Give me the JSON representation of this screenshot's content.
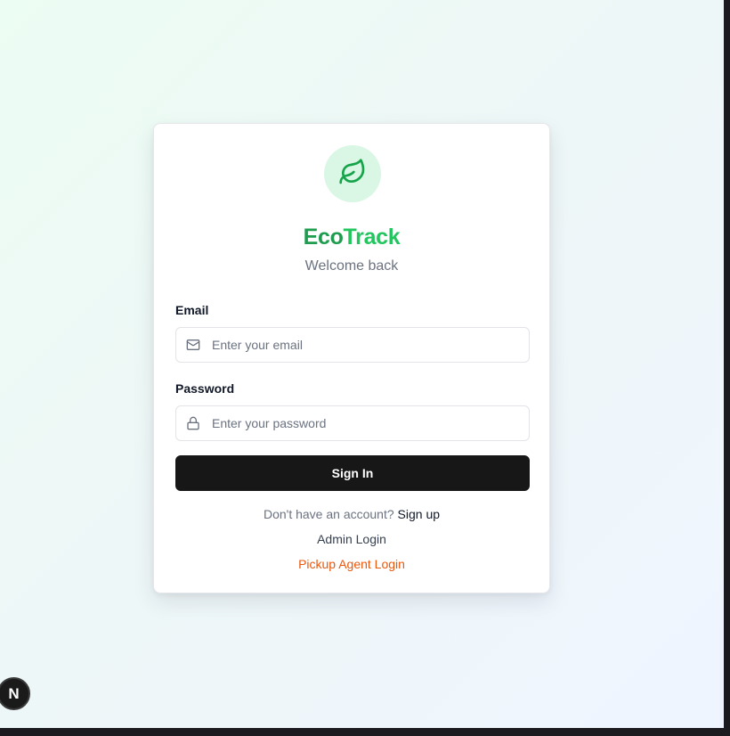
{
  "app": {
    "brand_part1": "Eco",
    "brand_part2": "Track",
    "subtitle": "Welcome back",
    "logo_icon": "leaf-icon",
    "accent_color": "#16a34a"
  },
  "form": {
    "email": {
      "label": "Email",
      "placeholder": "Enter your email",
      "value": "",
      "icon": "mail-icon"
    },
    "password": {
      "label": "Password",
      "placeholder": "Enter your password",
      "value": "",
      "icon": "lock-icon"
    },
    "submit_label": "Sign In"
  },
  "footer": {
    "signup_prompt": "Don't have an account?",
    "signup_link": "Sign up",
    "admin_link": "Admin Login",
    "agent_link": "Pickup Agent Login",
    "agent_link_color": "#ea580c"
  },
  "dev_badge": {
    "label": "N",
    "icon": "nextjs-badge-icon"
  }
}
